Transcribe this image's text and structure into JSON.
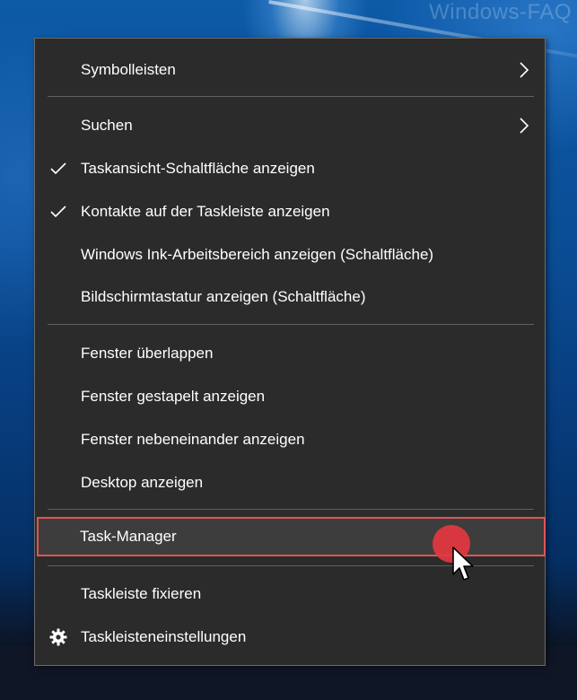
{
  "watermark": "Windows-FAQ",
  "menu": {
    "sections": [
      {
        "items": [
          {
            "label": "Symbolleisten",
            "submenu": true
          }
        ]
      },
      {
        "items": [
          {
            "label": "Suchen",
            "submenu": true
          },
          {
            "label": "Taskansicht-Schaltfläche anzeigen",
            "checked": true
          },
          {
            "label": "Kontakte auf der Taskleiste anzeigen",
            "checked": true
          },
          {
            "label": "Windows Ink-Arbeitsbereich anzeigen (Schaltfläche)"
          },
          {
            "label": "Bildschirmtastatur anzeigen (Schaltfläche)"
          }
        ]
      },
      {
        "items": [
          {
            "label": "Fenster überlappen"
          },
          {
            "label": "Fenster gestapelt anzeigen"
          },
          {
            "label": "Fenster nebeneinander anzeigen"
          },
          {
            "label": "Desktop anzeigen"
          }
        ]
      },
      {
        "items": [
          {
            "label": "Task-Manager",
            "highlighted": true
          }
        ]
      },
      {
        "items": [
          {
            "label": "Taskleiste fixieren"
          },
          {
            "label": "Taskleisteneinstellungen",
            "icon": "gear-icon"
          }
        ]
      }
    ]
  },
  "colors": {
    "menu_background": "#2b2b2b",
    "menu_text": "#ffffff",
    "separator": "#5f5f5f",
    "highlight_border": "#e05555",
    "click_indicator": "#e8373f"
  }
}
